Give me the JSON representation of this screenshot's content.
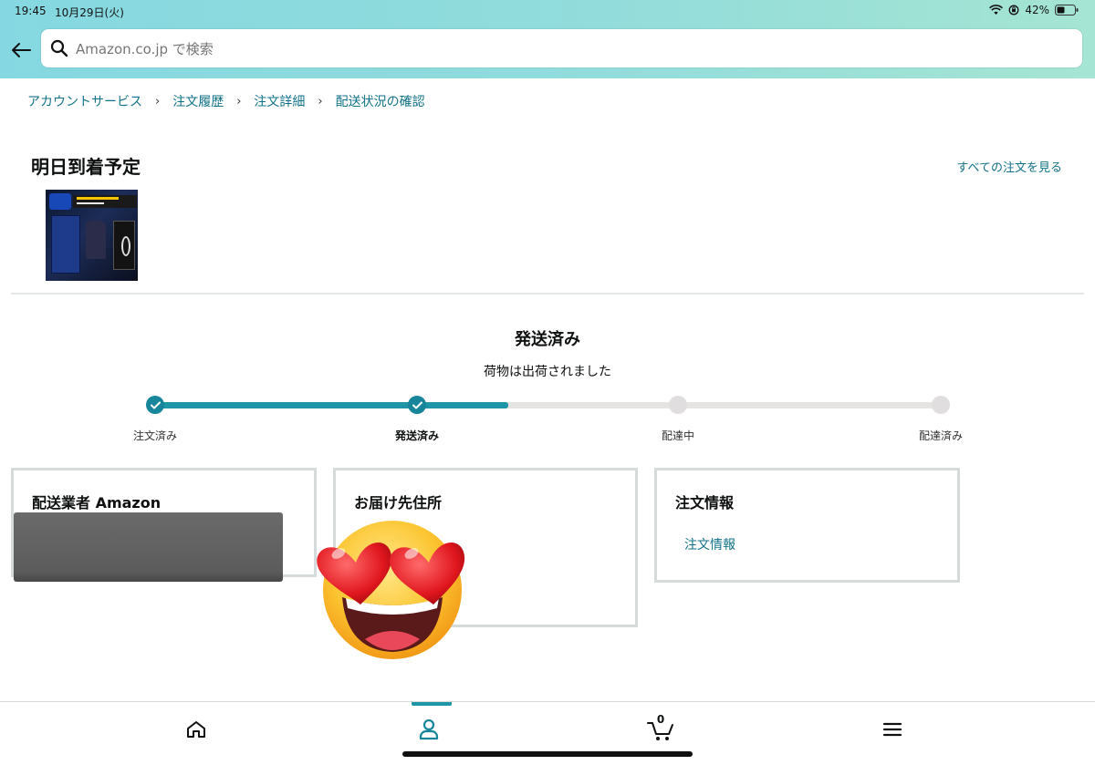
{
  "status_bar": {
    "time": "19:45",
    "date": "10月29日(火)",
    "battery": "42%"
  },
  "search": {
    "placeholder": "Amazon.co.jp で検索"
  },
  "breadcrumb": {
    "items": [
      "アカウントサービス",
      "注文履歴",
      "注文詳細",
      "配送状況の確認"
    ],
    "separator": "›"
  },
  "delivery": {
    "title": "明日到着予定",
    "all_orders_link": "すべての注文を見る"
  },
  "shipment": {
    "status": "発送済み",
    "substatus": "荷物は出荷されました",
    "progress": 0.45,
    "steps": [
      {
        "label": "注文済み",
        "done": true
      },
      {
        "label": "発送済み",
        "done": true,
        "current": true
      },
      {
        "label": "配達中",
        "done": false
      },
      {
        "label": "配達済み",
        "done": false
      }
    ]
  },
  "cards": {
    "carrier": {
      "title": "配送業者 Amazon"
    },
    "address": {
      "title": "お届け先住所"
    },
    "order": {
      "title": "注文情報",
      "link": "注文情報"
    }
  },
  "bottom_nav": {
    "cart_count": "0"
  },
  "colors": {
    "accent": "#1f96a6",
    "link": "#117289",
    "header_start": "#85d8e1",
    "header_end": "#a5e5d3"
  }
}
